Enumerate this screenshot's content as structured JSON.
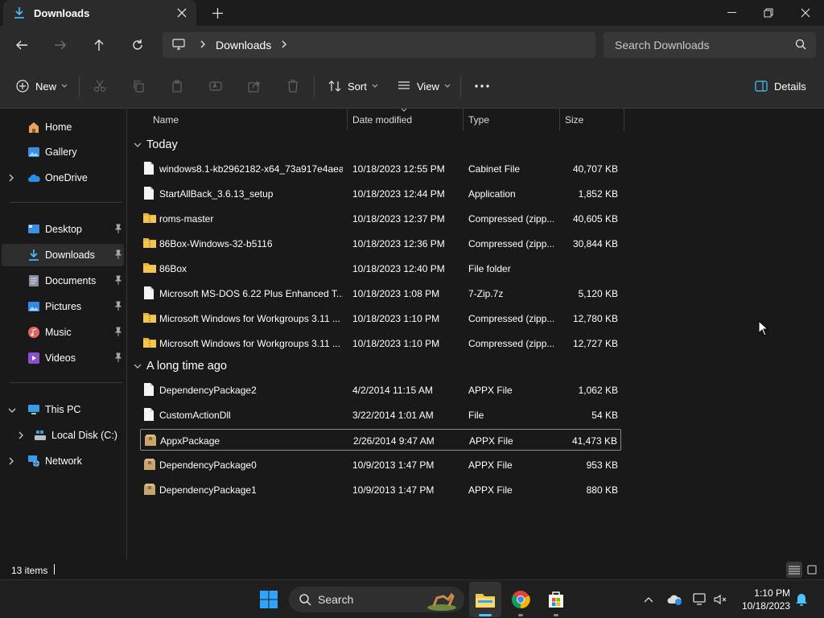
{
  "window": {
    "tab_title": "Downloads",
    "minimize_icon": "minimize-icon",
    "maximize_icon": "restore-icon",
    "close_icon": "close-icon"
  },
  "nav": {
    "breadcrumb": [
      "Downloads"
    ],
    "search_placeholder": "Search Downloads"
  },
  "commands": {
    "new": "New",
    "sort": "Sort",
    "view": "View",
    "details": "Details"
  },
  "sidebar": {
    "top": [
      {
        "label": "Home",
        "icon": "home-icon"
      },
      {
        "label": "Gallery",
        "icon": "gallery-icon"
      },
      {
        "label": "OneDrive",
        "icon": "onedrive-icon"
      }
    ],
    "pinned": [
      {
        "label": "Desktop",
        "icon": "desktop-icon"
      },
      {
        "label": "Downloads",
        "icon": "downloads-icon"
      },
      {
        "label": "Documents",
        "icon": "documents-icon"
      },
      {
        "label": "Pictures",
        "icon": "pictures-icon"
      },
      {
        "label": "Music",
        "icon": "music-icon"
      },
      {
        "label": "Videos",
        "icon": "videos-icon"
      }
    ],
    "tree": [
      {
        "label": "This PC",
        "icon": "this-pc-icon"
      },
      {
        "label": "Local Disk (C:)",
        "icon": "local-disk-icon"
      },
      {
        "label": "Network",
        "icon": "network-icon"
      }
    ]
  },
  "columns": {
    "name": "Name",
    "date": "Date modified",
    "type": "Type",
    "size": "Size"
  },
  "groups": [
    {
      "title": "Today",
      "files": [
        {
          "name": "windows8.1-kb2962182-x64_73a917e4aea...",
          "date": "10/18/2023 12:55 PM",
          "type": "Cabinet File",
          "size": "40,707 KB",
          "icon": "file-icon"
        },
        {
          "name": "StartAllBack_3.6.13_setup",
          "date": "10/18/2023 12:44 PM",
          "type": "Application",
          "size": "1,852 KB",
          "icon": "file-icon"
        },
        {
          "name": "roms-master",
          "date": "10/18/2023 12:37 PM",
          "type": "Compressed (zipp...",
          "size": "40,605 KB",
          "icon": "zip-folder-icon"
        },
        {
          "name": "86Box-Windows-32-b5116",
          "date": "10/18/2023 12:36 PM",
          "type": "Compressed (zipp...",
          "size": "30,844 KB",
          "icon": "zip-folder-icon"
        },
        {
          "name": "86Box",
          "date": "10/18/2023 12:40 PM",
          "type": "File folder",
          "size": "",
          "icon": "folder-icon"
        },
        {
          "name": "Microsoft MS-DOS 6.22 Plus Enhanced T...",
          "date": "10/18/2023 1:08 PM",
          "type": "7-Zip.7z",
          "size": "5,120 KB",
          "icon": "file-icon"
        },
        {
          "name": "Microsoft Windows for Workgroups 3.11 ...",
          "date": "10/18/2023 1:10 PM",
          "type": "Compressed (zipp...",
          "size": "12,780 KB",
          "icon": "zip-folder-icon"
        },
        {
          "name": "Microsoft Windows for Workgroups 3.11 ...",
          "date": "10/18/2023 1:10 PM",
          "type": "Compressed (zipp...",
          "size": "12,727 KB",
          "icon": "zip-folder-icon"
        }
      ]
    },
    {
      "title": "A long time ago",
      "files": [
        {
          "name": "DependencyPackage2",
          "date": "4/2/2014 11:15 AM",
          "type": "APPX File",
          "size": "1,062 KB",
          "icon": "file-icon"
        },
        {
          "name": "CustomActionDll",
          "date": "3/22/2014 1:01 AM",
          "type": "File",
          "size": "54 KB",
          "icon": "file-icon"
        },
        {
          "name": "AppxPackage",
          "date": "2/26/2014 9:47 AM",
          "type": "APPX File",
          "size": "41,473 KB",
          "icon": "package-icon"
        },
        {
          "name": "DependencyPackage0",
          "date": "10/9/2013 1:47 PM",
          "type": "APPX File",
          "size": "953 KB",
          "icon": "package-icon"
        },
        {
          "name": "DependencyPackage1",
          "date": "10/9/2013 1:47 PM",
          "type": "APPX File",
          "size": "880 KB",
          "icon": "package-icon"
        }
      ]
    }
  ],
  "status": {
    "item_count": "13 items"
  },
  "taskbar": {
    "search_label": "Search",
    "time": "1:10 PM",
    "date": "10/18/2023"
  },
  "colors": {
    "accent": "#4cc2ff",
    "folder": "#f3c74f",
    "package": "#c9a46b"
  }
}
